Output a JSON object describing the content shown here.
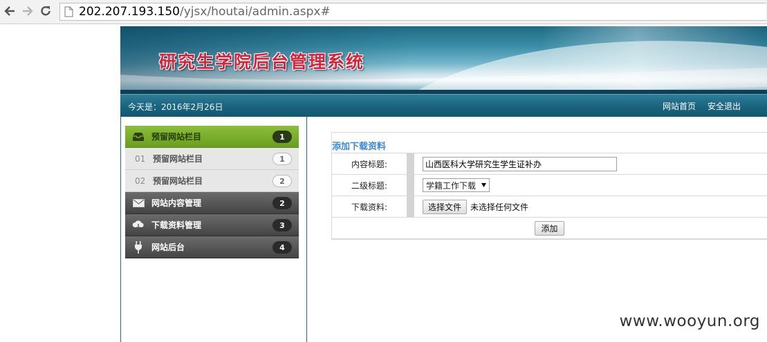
{
  "browser": {
    "url_host": "202.207.193.150",
    "url_path": "/yjsx/houtai/admin.aspx#"
  },
  "banner": {
    "title": "研究生学院后台管理系统"
  },
  "infobar": {
    "date": "今天是：2016年2月26日",
    "home_link": "网站首页",
    "logout_link": "安全退出"
  },
  "menu": {
    "items": [
      {
        "label": "预留网站栏目",
        "badge": "1",
        "icon": "inbox-icon",
        "state": "active"
      },
      {
        "num": "01",
        "label": "预留网站栏目",
        "badge": "1",
        "state": "sub"
      },
      {
        "num": "02",
        "label": "预留网站栏目",
        "badge": "2",
        "state": "sub"
      },
      {
        "label": "网站内容管理",
        "badge": "2",
        "icon": "envelope-icon",
        "state": "dark"
      },
      {
        "label": "下载资料管理",
        "badge": "3",
        "icon": "cloud-download-icon",
        "state": "dark"
      },
      {
        "label": "网站后台",
        "badge": "4",
        "icon": "plug-icon",
        "state": "dark"
      }
    ]
  },
  "form": {
    "title": "添加下载资料",
    "content_title_label": "内容标题:",
    "content_title_value": "山西医科大学研究生学生证补办",
    "sub_title_label": "二级标题:",
    "sub_title_selected": "学籍工作下载",
    "download_label": "下载资料:",
    "choose_file_button": "选择文件",
    "no_file_text": "未选择任何文件",
    "add_button": "添加"
  },
  "watermark": "www.wooyun.org",
  "colors": {
    "accent_green": "#7aae2a",
    "banner_blue": "#1b6680",
    "banner_title_red": "#d4243c",
    "form_title_blue": "#3a8ad6"
  }
}
